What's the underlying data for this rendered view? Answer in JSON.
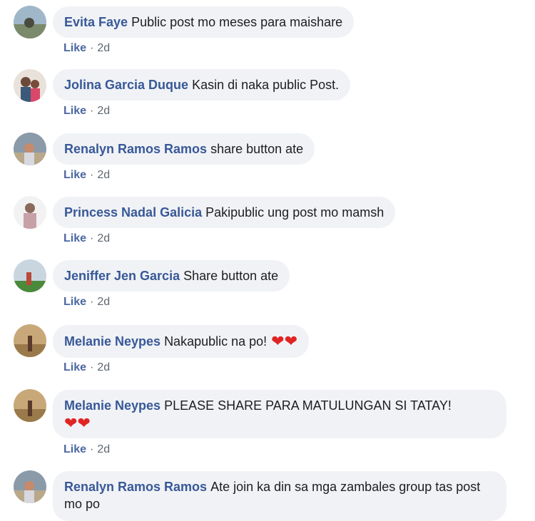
{
  "comments": [
    {
      "author": "Evita Faye",
      "text": "Public post mo meses para maishare",
      "like_label": "Like",
      "separator": "·",
      "time": "2d",
      "avatar_icon": "avatar-icon"
    },
    {
      "author": "Jolina Garcia Duque",
      "text": "Kasin di naka public Post.",
      "like_label": "Like",
      "separator": "·",
      "time": "2d",
      "avatar_icon": "avatar-icon"
    },
    {
      "author": "Renalyn Ramos Ramos",
      "text": "share button ate",
      "like_label": "Like",
      "separator": "·",
      "time": "2d",
      "avatar_icon": "avatar-icon"
    },
    {
      "author": "Princess Nadal Galicia",
      "text": "Pakipublic ung post mo mamsh",
      "like_label": "Like",
      "separator": "·",
      "time": "2d",
      "avatar_icon": "avatar-icon"
    },
    {
      "author": "Jeniffer Jen Garcia",
      "text": "Share button ate",
      "like_label": "Like",
      "separator": "·",
      "time": "2d",
      "avatar_icon": "avatar-icon"
    },
    {
      "author": "Melanie Neypes",
      "text": "Nakapublic na po!",
      "emoji": "❤❤",
      "like_label": "Like",
      "separator": "·",
      "time": "2d",
      "avatar_icon": "avatar-icon"
    },
    {
      "author": "Melanie Neypes",
      "text": "PLEASE SHARE PARA MATULUNGAN SI TATAY!",
      "emoji": "❤❤",
      "like_label": "Like",
      "separator": "·",
      "time": "2d",
      "avatar_icon": "avatar-icon"
    },
    {
      "author": "Renalyn Ramos Ramos",
      "text": "Ate join ka din sa mga zambales group tas post mo po",
      "avatar_icon": "avatar-icon"
    }
  ],
  "colors": {
    "author": "#385898",
    "bubble": "#f0f2f5",
    "like": "#4b67a1",
    "heart": "#e02424"
  }
}
